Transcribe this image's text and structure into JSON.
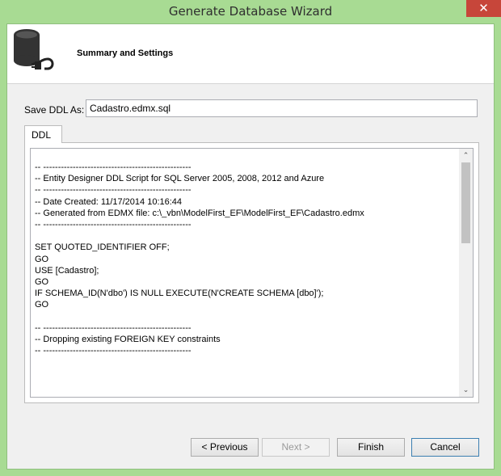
{
  "window": {
    "title": "Generate Database Wizard",
    "close_glyph": "✕"
  },
  "header": {
    "title": "Summary and Settings",
    "icon": "database-plug-icon"
  },
  "save_ddl": {
    "label": "Save DDL As:",
    "value": "Cadastro.edmx.sql"
  },
  "tab": {
    "label": "DDL"
  },
  "ddl_text": "-- --------------------------------------------------\n-- Entity Designer DDL Script for SQL Server 2005, 2008, 2012 and Azure\n-- --------------------------------------------------\n-- Date Created: 11/17/2014 10:16:44\n-- Generated from EDMX file: c:\\_vbn\\ModelFirst_EF\\ModelFirst_EF\\Cadastro.edmx\n-- --------------------------------------------------\n\nSET QUOTED_IDENTIFIER OFF;\nGO\nUSE [Cadastro];\nGO\nIF SCHEMA_ID(N'dbo') IS NULL EXECUTE(N'CREATE SCHEMA [dbo]');\nGO\n\n-- --------------------------------------------------\n-- Dropping existing FOREIGN KEY constraints\n-- --------------------------------------------------",
  "scrollbar": {
    "up_glyph": "⌃",
    "down_glyph": "⌄"
  },
  "buttons": {
    "previous": "< Previous",
    "next": "Next >",
    "finish": "Finish",
    "cancel": "Cancel"
  },
  "colors": {
    "frame": "#a8db93",
    "close_button": "#c7463a",
    "default_button_border": "#3c7fb1"
  }
}
